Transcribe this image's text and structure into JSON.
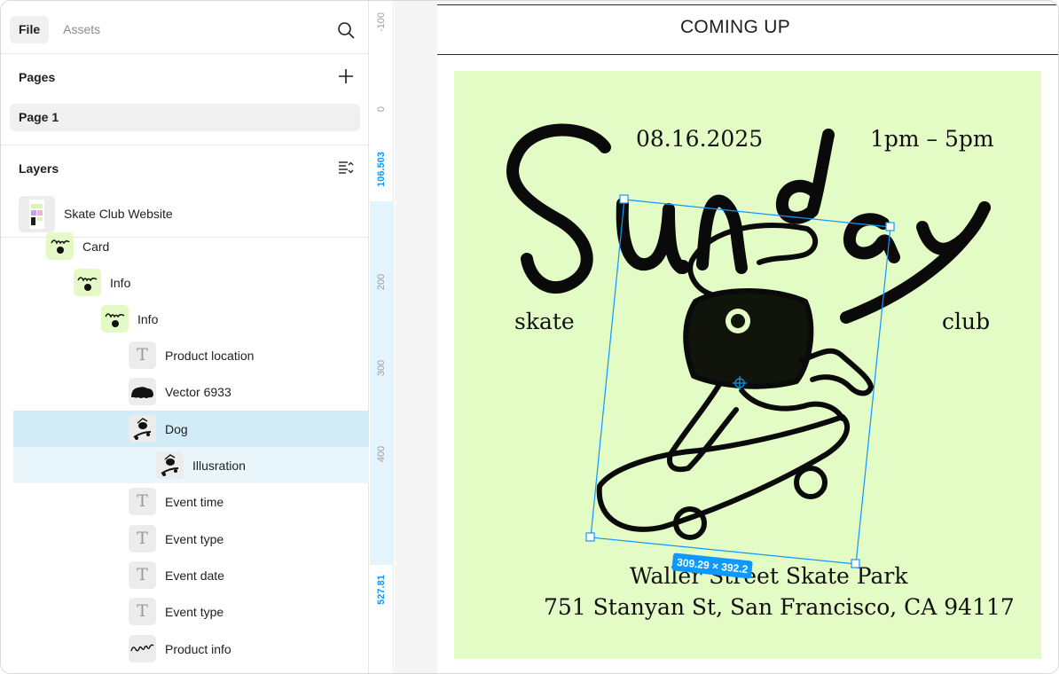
{
  "panel": {
    "tabs": [
      {
        "label": "File",
        "active": true
      },
      {
        "label": "Assets",
        "active": false
      }
    ],
    "pages_title": "Pages",
    "pages": [
      "Page 1"
    ],
    "layers_title": "Layers",
    "root_layer": "Skate Club Website",
    "layers": [
      {
        "label": "Card",
        "icon": "frame-thumbnail"
      },
      {
        "label": "Info",
        "icon": "frame-thumbnail"
      },
      {
        "label": "Info",
        "icon": "frame-thumbnail"
      },
      {
        "label": "Product location",
        "icon": "text-icon"
      },
      {
        "label": "Vector 6933",
        "icon": "vector-thumbnail"
      },
      {
        "label": "Dog",
        "icon": "dog-thumbnail",
        "state": "selected"
      },
      {
        "label": "Illusration",
        "icon": "dog-thumbnail",
        "state": "child-of-selected"
      },
      {
        "label": "Event time",
        "icon": "text-icon"
      },
      {
        "label": "Event type",
        "icon": "text-icon"
      },
      {
        "label": "Event date",
        "icon": "text-icon"
      },
      {
        "label": "Event type",
        "icon": "text-icon"
      },
      {
        "label": "Product info",
        "icon": "sunday-thumbnail"
      }
    ]
  },
  "ruler": {
    "labels": [
      "-100",
      "0",
      "106.503",
      "200",
      "300",
      "400",
      "527.81"
    ],
    "selection_start": "106.503",
    "selection_end": "527.81"
  },
  "canvas": {
    "page_header": "COMING UP",
    "poster": {
      "headline": "Sunday",
      "date": "08.16.2025",
      "time": "1pm – 5pm",
      "left_word": "skate",
      "right_word": "club",
      "venue": "Waller Street Skate Park",
      "address": "751 Stanyan St, San Francisco, CA 94117",
      "background": "#e3fbc4"
    },
    "selection": {
      "dimensions": "309.29 × 392.2",
      "color": "#0d99ff"
    }
  },
  "colors": {
    "selected_row": "#d2ecf7",
    "child_row": "#e9f6fc",
    "accent": "#0d99ff"
  }
}
